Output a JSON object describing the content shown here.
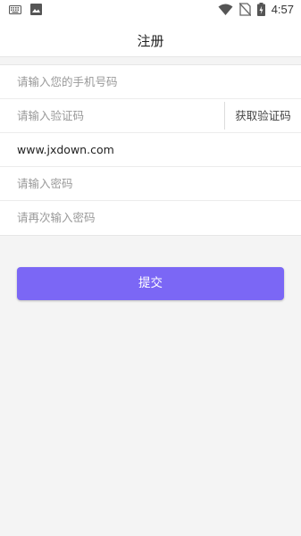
{
  "status_bar": {
    "time": "4:57",
    "icons": [
      "keyboard-icon",
      "image-icon",
      "wifi-icon",
      "no-sim-icon",
      "battery-charging-icon"
    ]
  },
  "header": {
    "title": "注册"
  },
  "form": {
    "phone": {
      "value": "",
      "placeholder": "请输入您的手机号码"
    },
    "code": {
      "value": "",
      "placeholder": "请输入验证码",
      "button_label": "获取验证码"
    },
    "username": {
      "value": "www.jxdown.com",
      "placeholder": ""
    },
    "password": {
      "value": "",
      "placeholder": "请输入密码"
    },
    "password_confirm": {
      "value": "",
      "placeholder": "请再次输入密码"
    }
  },
  "submit": {
    "label": "提交"
  },
  "colors": {
    "accent": "#7b67f5",
    "background": "#f4f4f4",
    "surface": "#ffffff"
  }
}
